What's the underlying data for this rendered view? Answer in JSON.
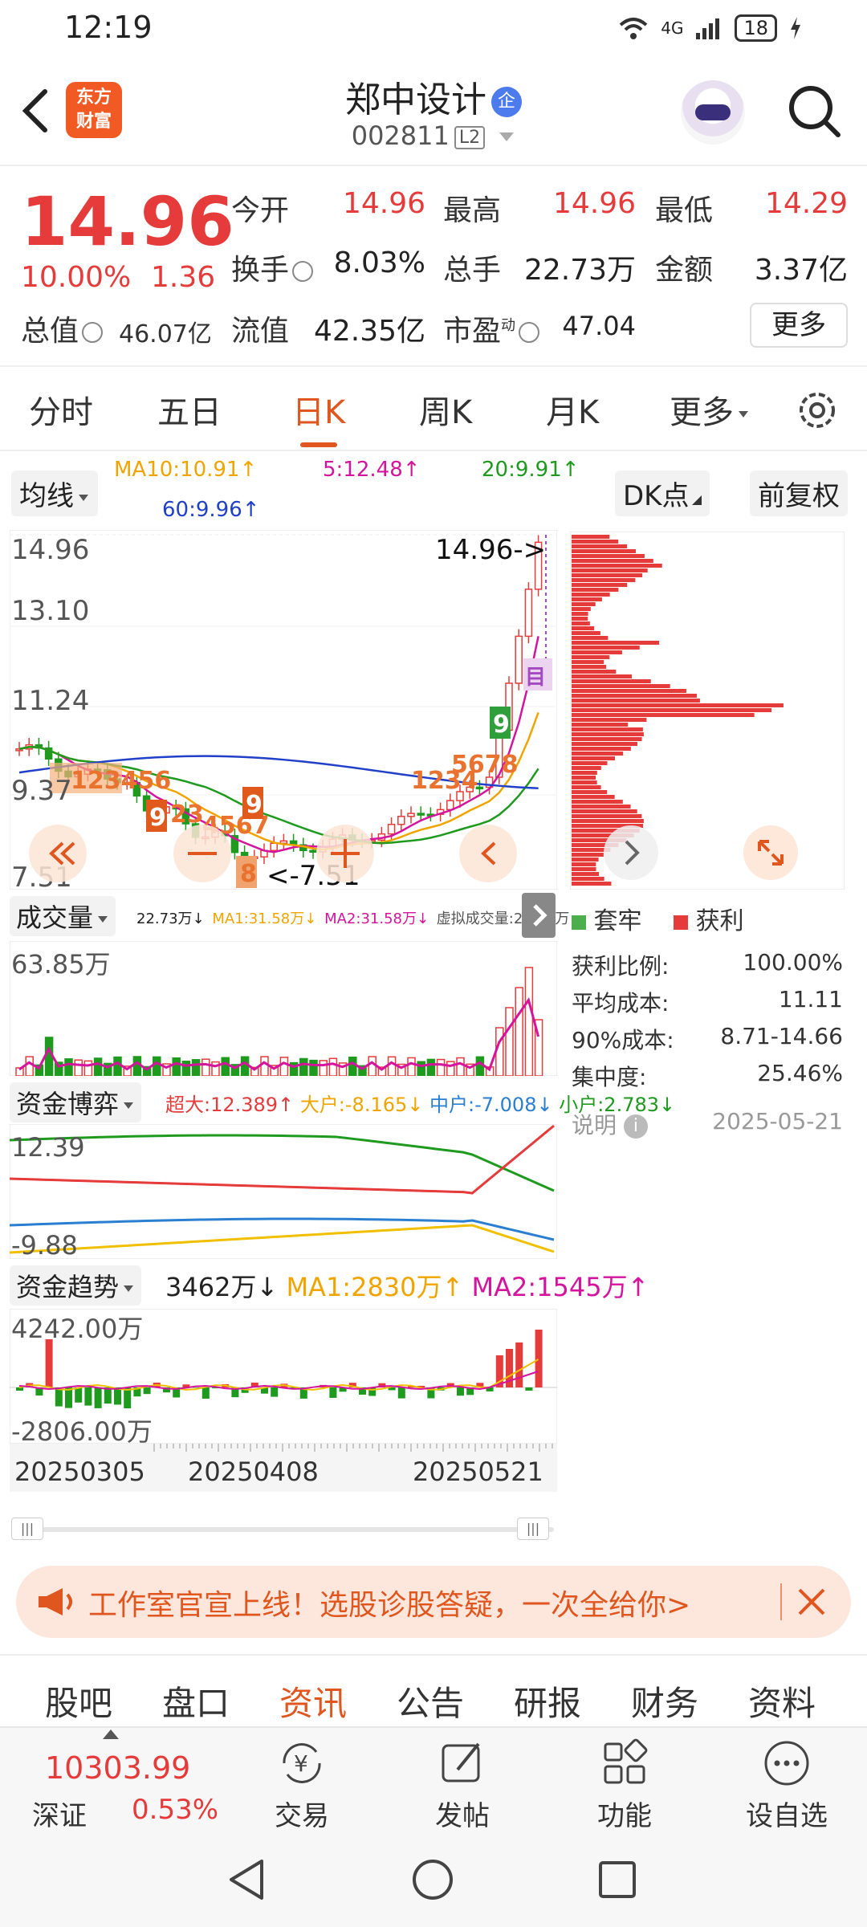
{
  "status": {
    "time": "12:19",
    "network": "4G",
    "battery": "18"
  },
  "header": {
    "app_logo": "东方\n财富",
    "stock_name": "郑中设计",
    "enterprise_badge": "企",
    "stock_code": "002811",
    "level": "L2"
  },
  "quote": {
    "price": "14.96",
    "pct": "10.00%",
    "change": "1.36",
    "open_label": "今开",
    "open": "14.96",
    "high_label": "最高",
    "high": "14.96",
    "low_label": "最低",
    "low": "14.29",
    "turnover_label": "换手",
    "turnover": "8.03%",
    "volume_label": "总手",
    "volume": "22.73万",
    "amount_label": "金额",
    "amount": "3.37亿",
    "mktcap_label": "总值",
    "mktcap": "46.07亿",
    "float_label": "流值",
    "float_cap": "42.35亿",
    "pe_label": "市盈",
    "pe_sup": "动",
    "pe": "47.04",
    "more": "更多"
  },
  "tabs": [
    "分时",
    "五日",
    "日K",
    "周K",
    "月K",
    "更多"
  ],
  "active_tab": "日K",
  "ma": {
    "selector": "均线",
    "ma10": "MA10:10.91↑",
    "ma5": "5:12.48↑",
    "ma20": "20:9.91↑",
    "ma60": "60:9.96↑",
    "dk": "DK点",
    "adjust": "前复权",
    "colors": {
      "ma5": "#d4149c",
      "ma10": "#f0a400",
      "ma20": "#1e9a1e",
      "ma60": "#2140c8"
    }
  },
  "kline": {
    "y_labels": [
      "14.96",
      "13.10",
      "11.24",
      "9.37",
      "7.51"
    ],
    "last_price_tag": "14.96->",
    "low_tag": "<-7.51",
    "signal_9_a": "9",
    "signal_9_b": "9",
    "signal_9_c": "9",
    "signal_8_a": "8",
    "signal_8_b": "8",
    "seq_a": "123456",
    "seq_b": "23",
    "seq_c": "4567",
    "seq_d": "1234",
    "seq_e": "5678",
    "mark_gou": "目"
  },
  "volume": {
    "selector": "成交量",
    "current": "22.73万↓",
    "ma1": "MA1:31.58万↓",
    "ma2": "MA2:31.58万↓",
    "virtual": "虚拟成交量:23.07万",
    "max_label": "63.85万"
  },
  "capital_game": {
    "selector": "资金博弈",
    "super": "超大:12.389↑",
    "big": "大户:-8.165↓",
    "mid": "中户:-7.008↓",
    "small": "小户:2.783↓",
    "top": "12.39",
    "bottom": "-9.88"
  },
  "capital_trend": {
    "selector": "资金趋势",
    "current": "3462万↓",
    "ma1": "MA1:2830万↑",
    "ma2": "MA2:1545万↑",
    "top": "4242.00万",
    "bottom": "-2806.00万"
  },
  "dates": [
    "20250305",
    "20250408",
    "20250521"
  ],
  "chip": {
    "legend_trapped": "套牢",
    "legend_profit": "获利",
    "rows": [
      {
        "label": "获利比例:",
        "value": "100.00%"
      },
      {
        "label": "平均成本:",
        "value": "11.11"
      },
      {
        "label": "90%成本:",
        "value": "8.71-14.66"
      },
      {
        "label": "集中度:",
        "value": "25.46%"
      }
    ],
    "note": "说明",
    "date": "2025-05-21"
  },
  "banner": {
    "text": "工作室官宣上线！选股诊股答疑，一次全给你>"
  },
  "info_tabs": [
    "股吧",
    "盘口",
    "资讯",
    "公告",
    "研报",
    "财务",
    "资料"
  ],
  "active_info_tab": "资讯",
  "toolbar": {
    "index_value": "10303.99",
    "index_name": "深证",
    "index_pct": "0.53%",
    "trade": "交易",
    "post": "发帖",
    "function": "功能",
    "watchlist": "设自选"
  }
}
